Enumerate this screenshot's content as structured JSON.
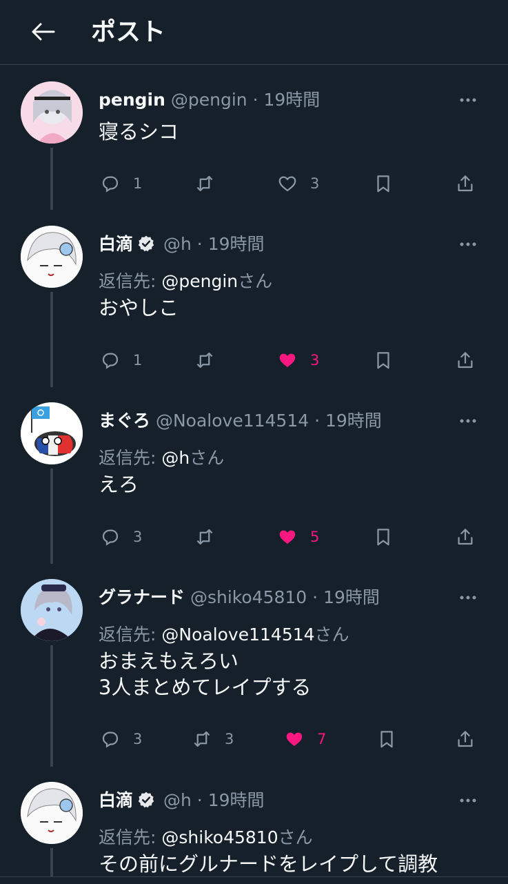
{
  "header": {
    "back_icon": "arrow-left-icon",
    "title": "ポスト"
  },
  "verified_icon": "verified-badge-icon",
  "colors": {
    "background": "#15202b",
    "muted": "#8b98a5",
    "like": "#f91880",
    "divider": "#38444d"
  },
  "posts": [
    {
      "name": "pengin",
      "verified": false,
      "handle": "@pengin",
      "dot": "·",
      "time": "19時間",
      "reply_prefix": "",
      "reply_handle": "",
      "reply_suffix": "",
      "text": [
        "寝るシコ"
      ],
      "replies": "1",
      "reposts": "",
      "likes": "3",
      "liked": false
    },
    {
      "name": "白滴",
      "verified": true,
      "handle": "@h",
      "dot": "·",
      "time": "19時間",
      "reply_prefix": "返信先: ",
      "reply_handle": "@pengin",
      "reply_suffix": "さん",
      "text": [
        "おやしこ"
      ],
      "replies": "1",
      "reposts": "",
      "likes": "3",
      "liked": true
    },
    {
      "name": "まぐろ",
      "verified": false,
      "handle": "@Noalove114514",
      "dot": "·",
      "time": "19時間",
      "reply_prefix": "返信先: ",
      "reply_handle": "@h",
      "reply_suffix": "さん",
      "text": [
        "えろ"
      ],
      "replies": "3",
      "reposts": "",
      "likes": "5",
      "liked": true
    },
    {
      "name": "グラナード",
      "verified": false,
      "handle": "@shiko45810",
      "dot": "·",
      "time": "19時間",
      "reply_prefix": "返信先: ",
      "reply_handle": "@Noalove114514",
      "reply_suffix": "さん",
      "text": [
        "おまえもえろい",
        "3人まとめてレイプする"
      ],
      "replies": "3",
      "reposts": "3",
      "likes": "7",
      "liked": true
    },
    {
      "name": "白滴",
      "verified": true,
      "handle": "@h",
      "dot": "·",
      "time": "19時間",
      "reply_prefix": "返信先: ",
      "reply_handle": "@shiko45810",
      "reply_suffix": "さん",
      "text": [
        "その前にグルナードをレイプして調教"
      ],
      "replies": "",
      "reposts": "",
      "likes": "",
      "liked": false
    }
  ]
}
